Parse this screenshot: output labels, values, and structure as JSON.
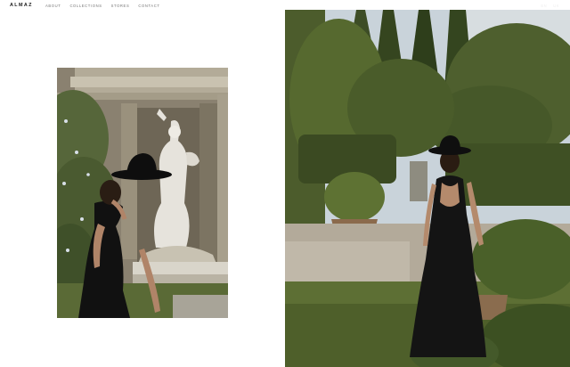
{
  "header": {
    "logo": "ALMAZ",
    "nav": [
      {
        "label": "ABOUT"
      },
      {
        "label": "COLLECTIONS"
      },
      {
        "label": "STORES"
      },
      {
        "label": "CONTACT"
      }
    ],
    "languages": [
      {
        "label": "EN"
      },
      {
        "label": "UK"
      }
    ]
  },
  "gallery": {
    "left_photo": "photo of woman in black hat and dress beside a classical statue niche",
    "right_photo": "photo of woman in black dress and hat walking through a garden"
  },
  "colors": {
    "background": "#ffffff",
    "text": "#1a1a1a",
    "nav_text": "#777777"
  }
}
